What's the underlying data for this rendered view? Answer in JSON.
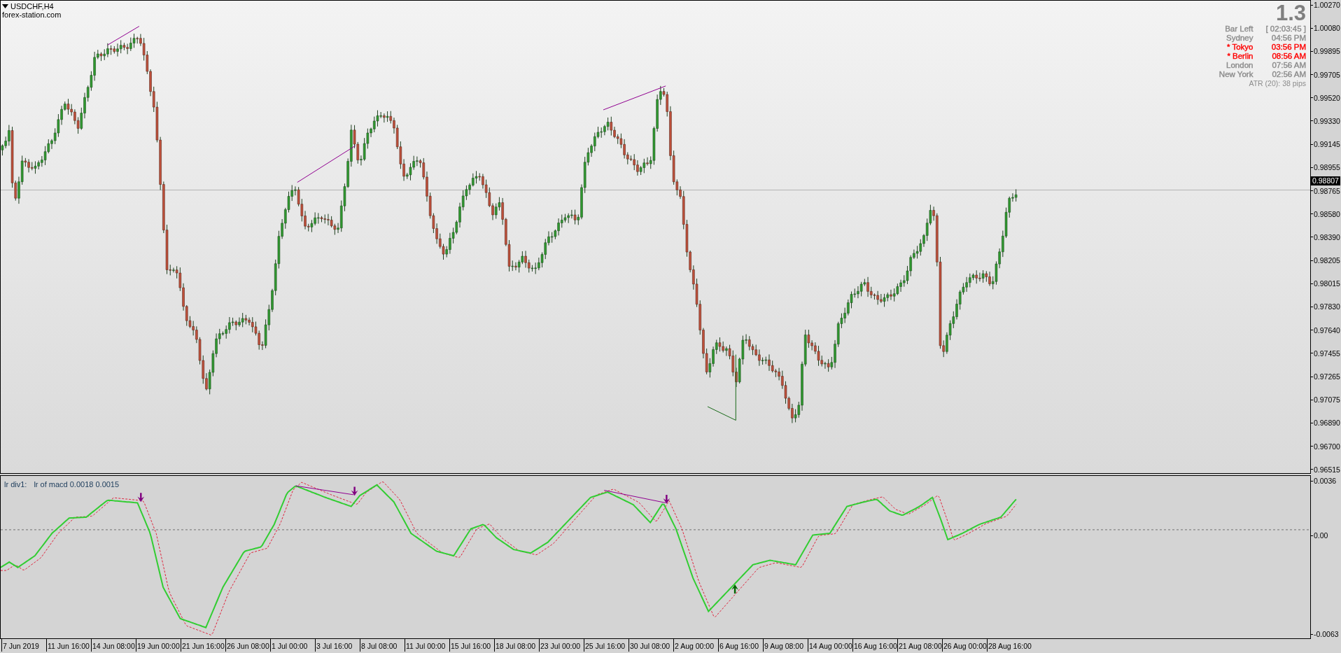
{
  "chart": {
    "symbol": "USDCHF,H4",
    "site_label": "forex-station.com"
  },
  "info_panel": {
    "spread": "1.3",
    "rows": [
      {
        "label": "Bar Left",
        "value": "[ 02:03:45 ]",
        "color": "#8c8c8c"
      },
      {
        "label": "Sydney",
        "value": "04:56 PM",
        "color": "#8c8c8c"
      },
      {
        "label": "* Tokyo",
        "value": "03:56 PM",
        "color": "#ff0000"
      },
      {
        "label": "* Berlin",
        "value": "08:56 AM",
        "color": "#ff0000"
      },
      {
        "label": "London",
        "value": "07:56 AM",
        "color": "#8c8c8c"
      },
      {
        "label": "New York",
        "value": "02:56 AM",
        "color": "#8c8c8c"
      }
    ],
    "atr": "ATR (20): 38 pips"
  },
  "price_axis": {
    "ticks": [
      "1.00270",
      "1.00080",
      "0.99895",
      "0.99705",
      "0.99520",
      "0.99330",
      "0.99145",
      "0.98955",
      "0.98765",
      "0.98580",
      "0.98390",
      "0.98205",
      "0.98015",
      "0.97830",
      "0.97640",
      "0.97455",
      "0.97265",
      "0.97075",
      "0.96890",
      "0.96700",
      "0.96515"
    ],
    "current_price": "0.98807"
  },
  "indicator": {
    "name": "lr div1:",
    "values": "lr of macd 0.0018 0.0015",
    "axis_ticks": [
      "0.0036",
      "0.00",
      "-0.0063"
    ]
  },
  "time_axis": {
    "labels": [
      "7 Jun 2019",
      "11 Jun 16:00",
      "14 Jun 08:00",
      "19 Jun 00:00",
      "21 Jun 16:00",
      "26 Jun 08:00",
      "1 Jul 00:00",
      "3 Jul 16:00",
      "8 Jul 08:00",
      "11 Jul 00:00",
      "15 Jul 16:00",
      "18 Jul 08:00",
      "23 Jul 00:00",
      "25 Jul 16:00",
      "30 Jul 08:00",
      "2 Aug 00:00",
      "6 Aug 16:00",
      "9 Aug 08:00",
      "14 Aug 00:00",
      "16 Aug 16:00",
      "21 Aug 08:00",
      "26 Aug 00:00",
      "28 Aug 16:00"
    ]
  }
}
